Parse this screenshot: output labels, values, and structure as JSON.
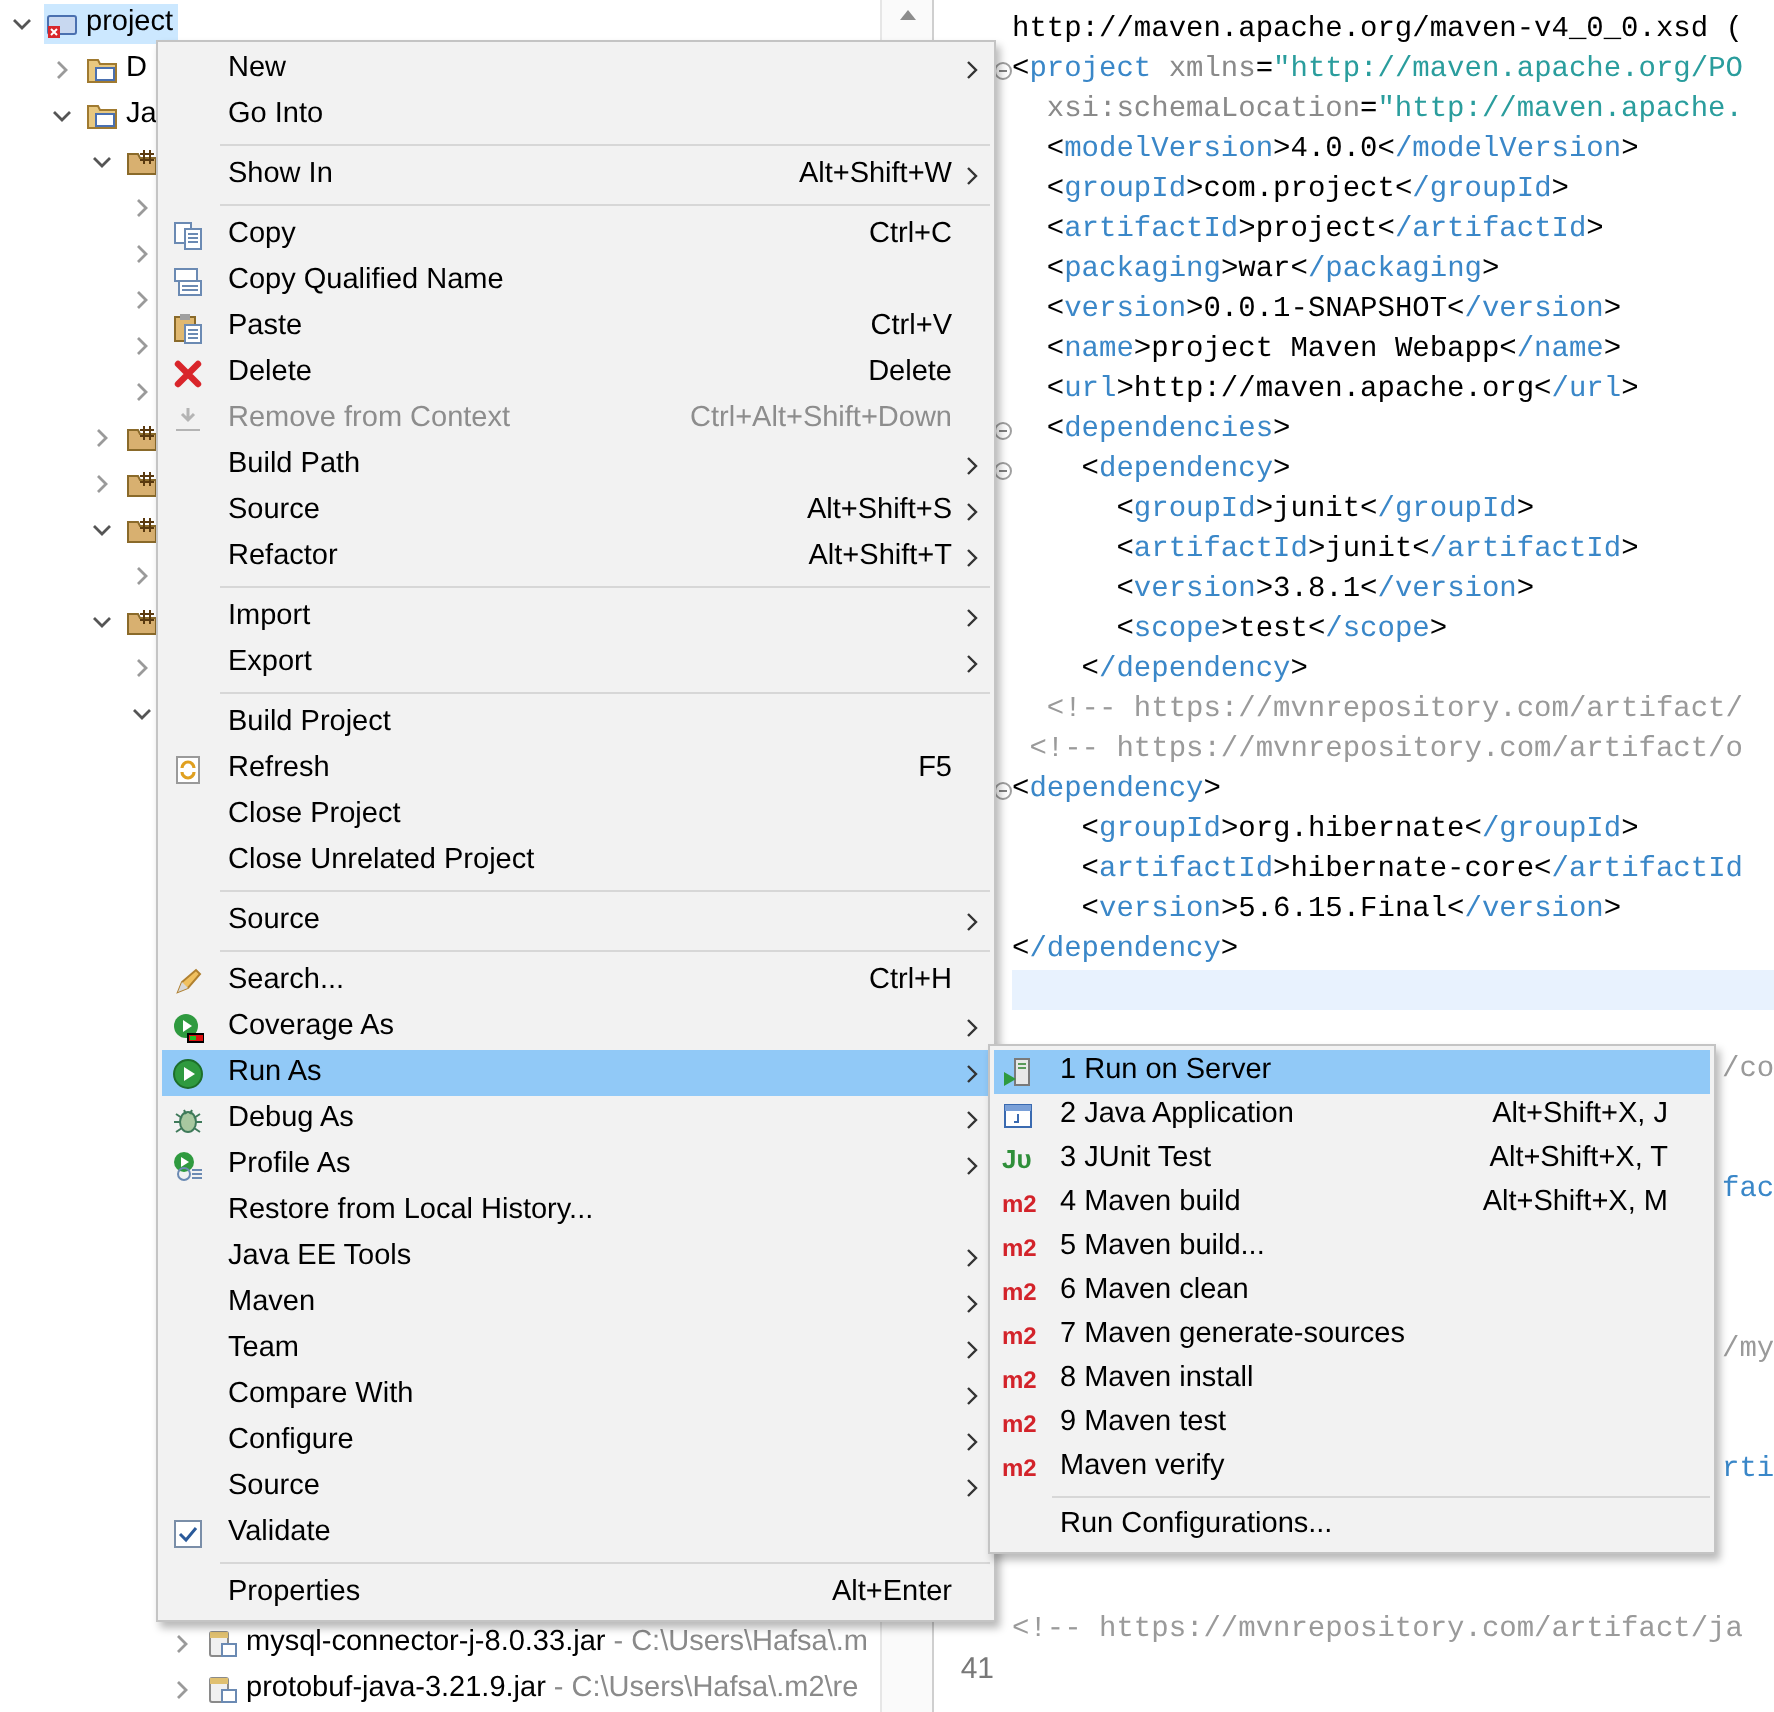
{
  "explorer": {
    "tree": [
      {
        "label": "project",
        "selected": true,
        "expanded": true,
        "children": [
          {
            "label": "D",
            "selected": false,
            "expanded": false
          },
          {
            "label": "Ja",
            "selected": false,
            "expanded": true,
            "children": [
              {
                "selected": false,
                "expanded": true,
                "children": [
                  {
                    "selected": false,
                    "expanded": false
                  },
                  {
                    "selected": false,
                    "expanded": false
                  },
                  {
                    "selected": false,
                    "expanded": false
                  },
                  {
                    "selected": false,
                    "expanded": false
                  },
                  {
                    "selected": false,
                    "expanded": false
                  }
                ]
              },
              {
                "selected": false,
                "expanded": false
              },
              {
                "selected": false,
                "expanded": false
              },
              {
                "selected": false,
                "expanded": true,
                "children": [
                  {
                    "selected": false,
                    "expanded": false
                  }
                ]
              },
              {
                "selected": false,
                "expanded": true,
                "children": [
                  {
                    "selected": false,
                    "expanded": false
                  },
                  {
                    "selected": false,
                    "expanded": true,
                    "children": [
                      {
                        "label": "mysql-connector-j-8.0.33.jar",
                        "path": "- C:\\Users\\Hafsa\\.m",
                        "selected": false,
                        "expanded": false
                      },
                      {
                        "label": "protobuf-java-3.21.9.jar",
                        "path": "- C:\\Users\\Hafsa\\.m2\\re",
                        "selected": false,
                        "expanded": false
                      }
                    ]
                  }
                ]
              }
            ]
          }
        ]
      }
    ]
  },
  "editor": {
    "lines": [
      {
        "kind": "code",
        "text": "http://maven.apache.org/maven-v4_0_0.xsd ("
      },
      {
        "kind": "code",
        "text": "<project xmlns=\"http://maven.apache.org/PO",
        "collapsible": true
      },
      {
        "kind": "attr",
        "text": "  xsi:schemaLocation=\"http://maven.apache."
      },
      {
        "kind": "code",
        "text": "  <modelVersion>4.0.0</modelVersion>"
      },
      {
        "kind": "code",
        "text": "  <groupId>com.project</groupId>"
      },
      {
        "kind": "code",
        "text": "  <artifactId>project</artifactId>"
      },
      {
        "kind": "code",
        "text": "  <packaging>war</packaging>"
      },
      {
        "kind": "code",
        "text": "  <version>0.0.1-SNAPSHOT</version>"
      },
      {
        "kind": "code",
        "text": "  <name>project Maven Webapp</name>"
      },
      {
        "kind": "code",
        "text": "  <url>http://maven.apache.org</url>"
      },
      {
        "kind": "code",
        "text": "  <dependencies>",
        "collapsible": true
      },
      {
        "kind": "code",
        "text": "    <dependency>",
        "collapsible": true
      },
      {
        "kind": "code",
        "text": "      <groupId>junit</groupId>"
      },
      {
        "kind": "code",
        "text": "      <artifactId>junit</artifactId>"
      },
      {
        "kind": "code",
        "text": "      <version>3.8.1</version>"
      },
      {
        "kind": "code",
        "text": "      <scope>test</scope>"
      },
      {
        "kind": "code",
        "text": "    </dependency>"
      },
      {
        "kind": "comment",
        "text": "  <!-- https://mvnrepository.com/artifact/"
      },
      {
        "kind": "comment",
        "text": " <!-- https://mvnrepository.com/artifact/o"
      },
      {
        "kind": "code",
        "text": "<dependency>",
        "collapsible": true
      },
      {
        "kind": "code",
        "text": "    <groupId>org.hibernate</groupId>"
      },
      {
        "kind": "code",
        "text": "    <artifactId>hibernate-core</artifactId"
      },
      {
        "kind": "code",
        "text": "    <version>5.6.15.Final</version>"
      },
      {
        "kind": "code",
        "text": "</dependency>"
      },
      {
        "kind": "current"
      },
      {
        "kind": "blank"
      },
      {
        "kind": "tail-comment",
        "text": "/co"
      },
      {
        "kind": "blank"
      },
      {
        "kind": "blank"
      },
      {
        "kind": "tail-tag",
        "text": "fac"
      },
      {
        "kind": "blank"
      },
      {
        "kind": "blank"
      },
      {
        "kind": "blank"
      },
      {
        "kind": "tail-comment",
        "text": "/my"
      },
      {
        "kind": "blank"
      },
      {
        "kind": "blank"
      },
      {
        "kind": "tail-tag",
        "text": "rti"
      },
      {
        "kind": "blank"
      },
      {
        "kind": "blank"
      },
      {
        "kind": "blank"
      },
      {
        "kind": "comment",
        "text": "<!-- https://mvnrepository.com/artifact/ja"
      },
      {
        "kind": "blank",
        "number": "41"
      }
    ]
  },
  "context_menu": {
    "items": [
      {
        "kind": "item",
        "label": "New",
        "submenu": true,
        "disabled": false,
        "selected": false,
        "checked": false
      },
      {
        "kind": "item",
        "label": "Go Into",
        "submenu": false,
        "disabled": false,
        "selected": false,
        "checked": false
      },
      {
        "kind": "separator"
      },
      {
        "kind": "item",
        "label": "Show In",
        "shortcut": "Alt+Shift+W",
        "submenu": true,
        "disabled": false,
        "selected": false,
        "checked": false
      },
      {
        "kind": "separator"
      },
      {
        "kind": "item",
        "label": "Copy",
        "shortcut": "Ctrl+C",
        "submenu": false,
        "disabled": false,
        "selected": false,
        "checked": false
      },
      {
        "kind": "item",
        "label": "Copy Qualified Name",
        "submenu": false,
        "disabled": false,
        "selected": false,
        "checked": false
      },
      {
        "kind": "item",
        "label": "Paste",
        "shortcut": "Ctrl+V",
        "submenu": false,
        "disabled": false,
        "selected": false,
        "checked": false
      },
      {
        "kind": "item",
        "label": "Delete",
        "shortcut": "Delete",
        "submenu": false,
        "disabled": false,
        "selected": false,
        "checked": false
      },
      {
        "kind": "item",
        "label": "Remove from Context",
        "shortcut": "Ctrl+Alt+Shift+Down",
        "submenu": false,
        "disabled": true,
        "selected": false,
        "checked": false
      },
      {
        "kind": "item",
        "label": "Build Path",
        "submenu": true,
        "disabled": false,
        "selected": false,
        "checked": false
      },
      {
        "kind": "item",
        "label": "Source",
        "shortcut": "Alt+Shift+S",
        "submenu": true,
        "disabled": false,
        "selected": false,
        "checked": false
      },
      {
        "kind": "item",
        "label": "Refactor",
        "shortcut": "Alt+Shift+T",
        "submenu": true,
        "disabled": false,
        "selected": false,
        "checked": false
      },
      {
        "kind": "separator"
      },
      {
        "kind": "item",
        "label": "Import",
        "submenu": true,
        "disabled": false,
        "selected": false,
        "checked": false
      },
      {
        "kind": "item",
        "label": "Export",
        "submenu": true,
        "disabled": false,
        "selected": false,
        "checked": false
      },
      {
        "kind": "separator"
      },
      {
        "kind": "item",
        "label": "Build Project",
        "submenu": false,
        "disabled": false,
        "selected": false,
        "checked": false
      },
      {
        "kind": "item",
        "label": "Refresh",
        "shortcut": "F5",
        "submenu": false,
        "disabled": false,
        "selected": false,
        "checked": false
      },
      {
        "kind": "item",
        "label": "Close Project",
        "submenu": false,
        "disabled": false,
        "selected": false,
        "checked": false
      },
      {
        "kind": "item",
        "label": "Close Unrelated Project",
        "submenu": false,
        "disabled": false,
        "selected": false,
        "checked": false
      },
      {
        "kind": "separator"
      },
      {
        "kind": "item",
        "label": "Source",
        "submenu": true,
        "disabled": false,
        "selected": false,
        "checked": false
      },
      {
        "kind": "separator"
      },
      {
        "kind": "item",
        "label": "Search...",
        "shortcut": "Ctrl+H",
        "submenu": false,
        "disabled": false,
        "selected": false,
        "checked": false
      },
      {
        "kind": "item",
        "label": "Coverage As",
        "submenu": true,
        "disabled": false,
        "selected": false,
        "checked": false
      },
      {
        "kind": "item",
        "label": "Run As",
        "submenu": true,
        "disabled": false,
        "selected": true,
        "checked": false
      },
      {
        "kind": "item",
        "label": "Debug As",
        "submenu": true,
        "disabled": false,
        "selected": false,
        "checked": false
      },
      {
        "kind": "item",
        "label": "Profile As",
        "submenu": true,
        "disabled": false,
        "selected": false,
        "checked": false
      },
      {
        "kind": "item",
        "label": "Restore from Local History...",
        "submenu": false,
        "disabled": false,
        "selected": false,
        "checked": false
      },
      {
        "kind": "item",
        "label": "Java EE Tools",
        "submenu": true,
        "disabled": false,
        "selected": false,
        "checked": false
      },
      {
        "kind": "item",
        "label": "Maven",
        "submenu": true,
        "disabled": false,
        "selected": false,
        "checked": false
      },
      {
        "kind": "item",
        "label": "Team",
        "submenu": true,
        "disabled": false,
        "selected": false,
        "checked": false
      },
      {
        "kind": "item",
        "label": "Compare With",
        "submenu": true,
        "disabled": false,
        "selected": false,
        "checked": false
      },
      {
        "kind": "item",
        "label": "Configure",
        "submenu": true,
        "disabled": false,
        "selected": false,
        "checked": false
      },
      {
        "kind": "item",
        "label": "Source",
        "submenu": true,
        "disabled": false,
        "selected": false,
        "checked": false
      },
      {
        "kind": "item",
        "label": "Validate",
        "submenu": false,
        "disabled": false,
        "selected": false,
        "checked": true
      },
      {
        "kind": "separator"
      },
      {
        "kind": "item",
        "label": "Properties",
        "shortcut": "Alt+Enter",
        "submenu": false,
        "disabled": false,
        "selected": false,
        "checked": false
      }
    ]
  },
  "run_as_menu": {
    "items": [
      {
        "kind": "item",
        "label": "1 Run on Server",
        "selected": true
      },
      {
        "kind": "item",
        "label": "2 Java Application",
        "shortcut": "Alt+Shift+X, J",
        "selected": false
      },
      {
        "kind": "item",
        "label": "3 JUnit Test",
        "shortcut": "Alt+Shift+X, T",
        "icon_text": "Jᴜ",
        "selected": false
      },
      {
        "kind": "item",
        "label": "4 Maven build",
        "shortcut": "Alt+Shift+X, M",
        "icon_text": "m2",
        "selected": false
      },
      {
        "kind": "item",
        "label": "5 Maven build...",
        "icon_text": "m2",
        "selected": false
      },
      {
        "kind": "item",
        "label": "6 Maven clean",
        "icon_text": "m2",
        "selected": false
      },
      {
        "kind": "item",
        "label": "7 Maven generate-sources",
        "icon_text": "m2",
        "selected": false
      },
      {
        "kind": "item",
        "label": "8 Maven install",
        "icon_text": "m2",
        "selected": false
      },
      {
        "kind": "item",
        "label": "9 Maven test",
        "icon_text": "m2",
        "selected": false
      },
      {
        "kind": "item",
        "label": "Maven verify",
        "icon_text": "m2",
        "selected": false
      },
      {
        "kind": "separator"
      },
      {
        "kind": "item",
        "label": "Run Configurations...",
        "selected": false
      }
    ]
  }
}
